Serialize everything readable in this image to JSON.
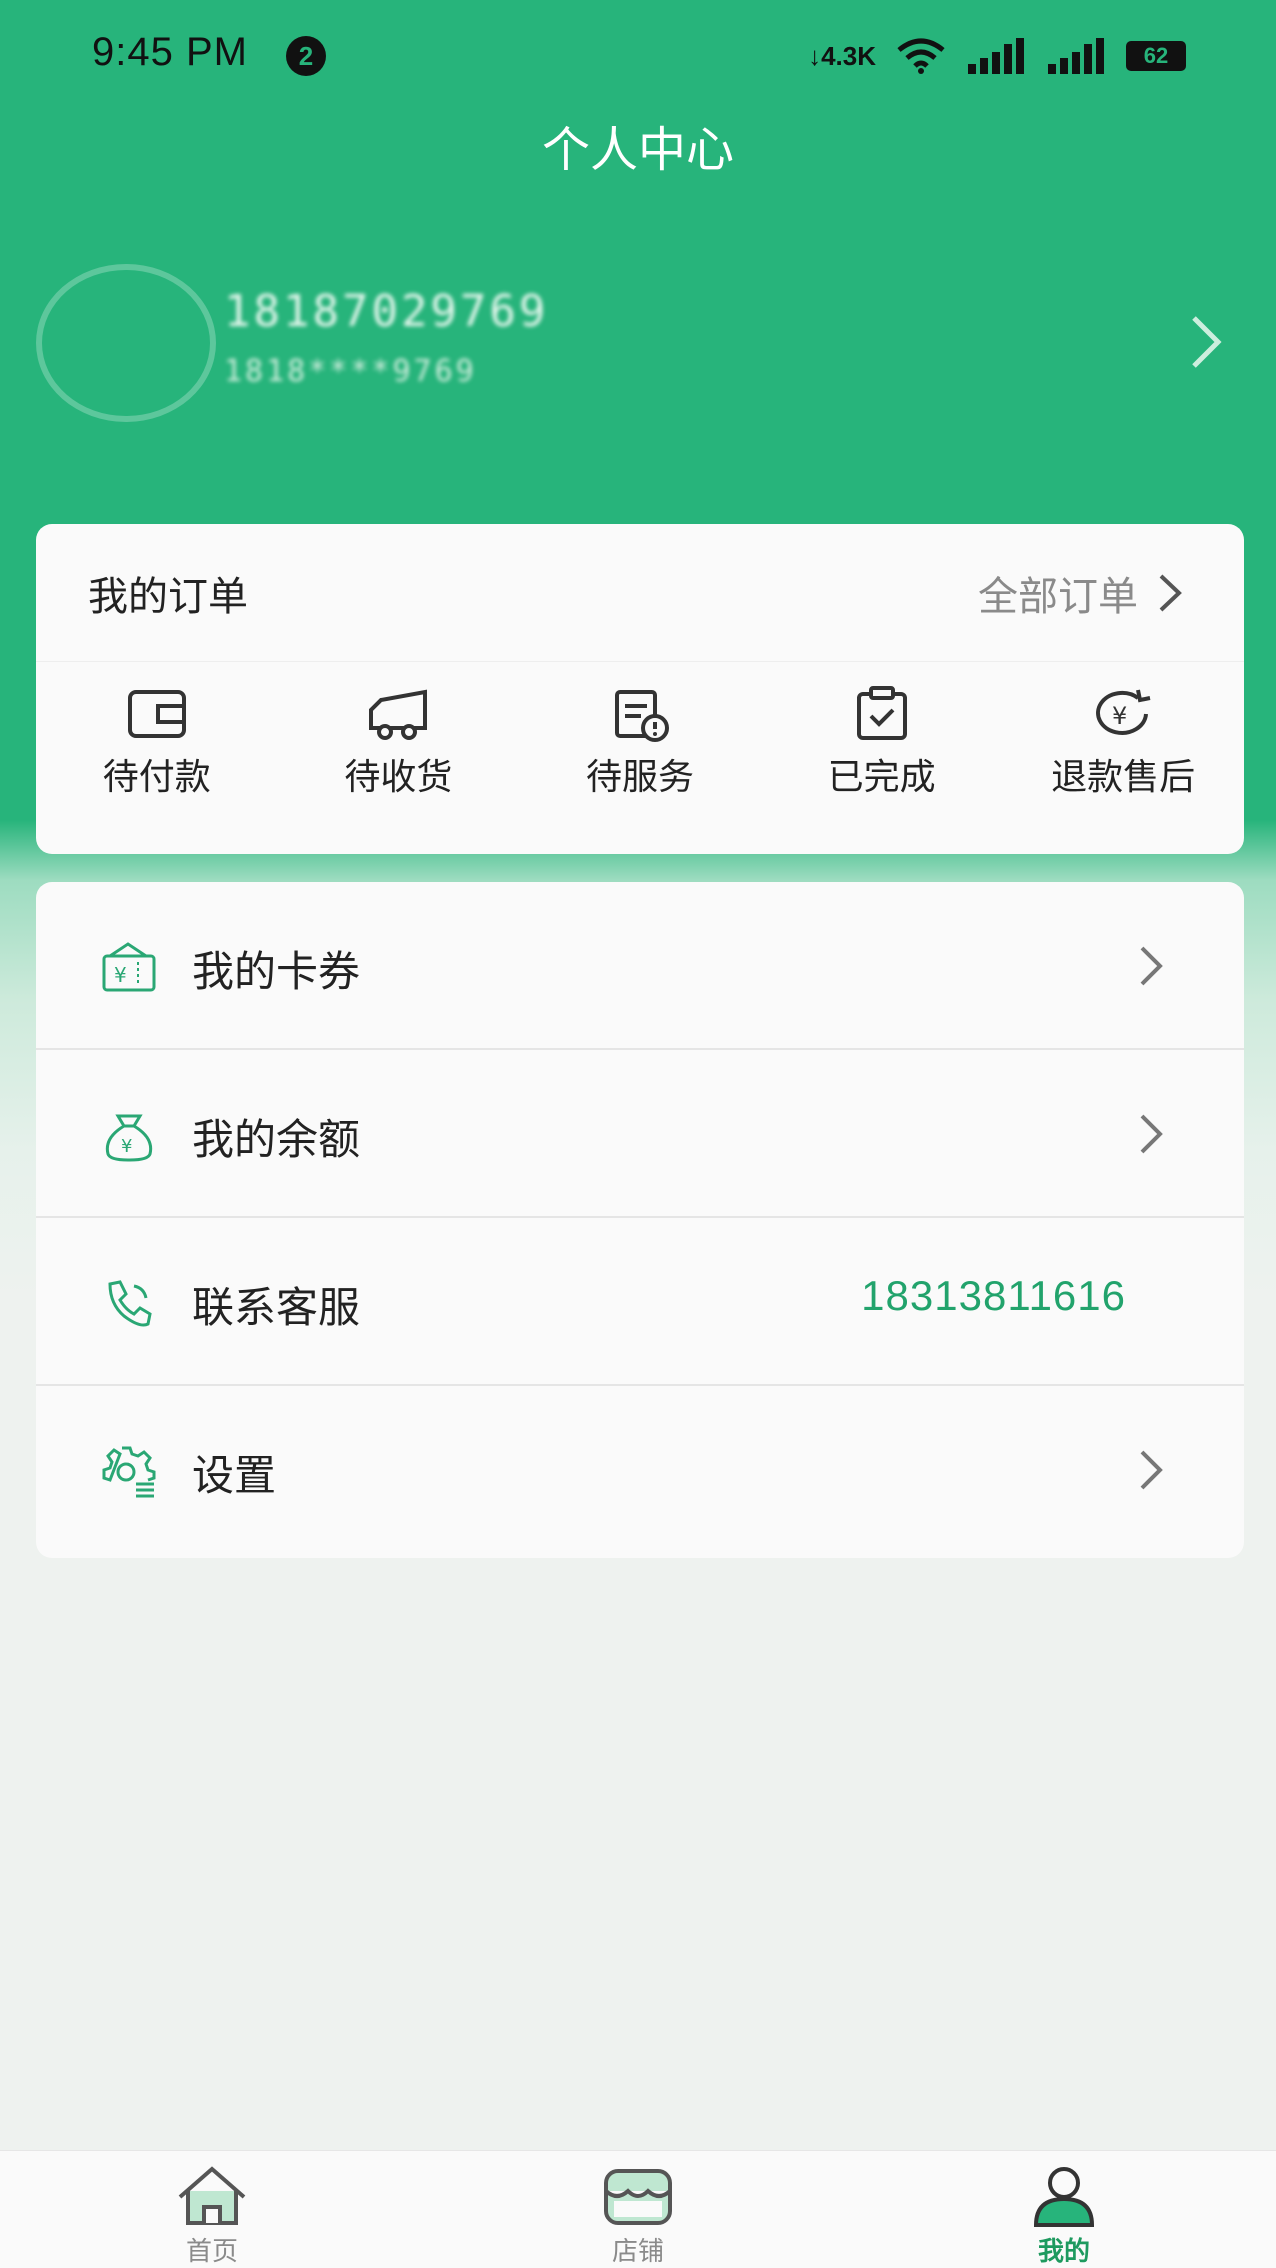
{
  "status_bar": {
    "time": "9:45 PM",
    "notification_count": "2",
    "net_speed": "↓4.3K",
    "battery": "62"
  },
  "header": {
    "title": "个人中心"
  },
  "profile": {
    "phone": "18187029769",
    "sub_phone": "1818****9769"
  },
  "orders": {
    "title": "我的订单",
    "all_label": "全部订单",
    "items": [
      {
        "label": "待付款",
        "icon": "wallet-icon"
      },
      {
        "label": "待收货",
        "icon": "truck-icon"
      },
      {
        "label": "待服务",
        "icon": "calendar-alert-icon"
      },
      {
        "label": "已完成",
        "icon": "clipboard-check-icon"
      },
      {
        "label": "退款售后",
        "icon": "refund-yen-icon"
      }
    ]
  },
  "menu": {
    "items": [
      {
        "label": "我的卡券",
        "icon": "coupon-icon",
        "value": "",
        "has_arrow": true
      },
      {
        "label": "我的余额",
        "icon": "money-bag-icon",
        "value": "",
        "has_arrow": true
      },
      {
        "label": "联系客服",
        "icon": "phone-icon",
        "value": "18313811616",
        "has_arrow": false
      },
      {
        "label": "设置",
        "icon": "gear-icon",
        "value": "",
        "has_arrow": true
      }
    ]
  },
  "tabbar": {
    "items": [
      {
        "label": "首页",
        "icon": "home-icon",
        "active": false
      },
      {
        "label": "店铺",
        "icon": "shop-icon",
        "active": false
      },
      {
        "label": "我的",
        "icon": "user-icon",
        "active": true
      }
    ]
  },
  "colors": {
    "primary": "#27b47b",
    "accent_text": "#22a36c",
    "active_tab": "#1e9a5f"
  }
}
